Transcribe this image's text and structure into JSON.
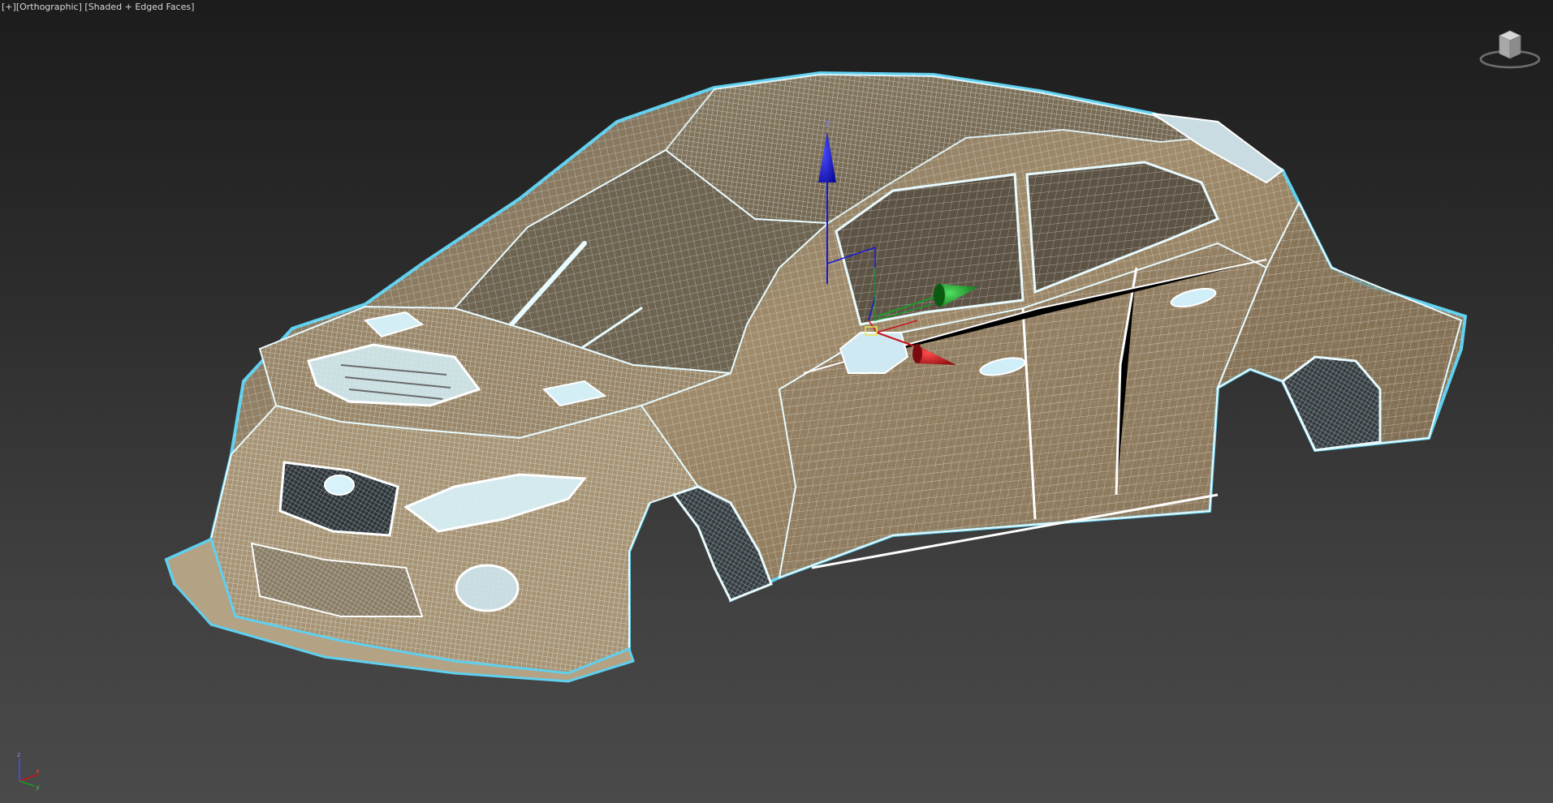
{
  "viewport": {
    "label_plus": "[+]",
    "label_view": "[Orthographic]",
    "label_shading": "[Shaded + Edged Faces]"
  },
  "gizmo": {
    "axis_z": "Z",
    "axis_x": "X",
    "axis_y": "Y"
  },
  "tripod": {
    "z": "z",
    "x": "x",
    "y": "y"
  },
  "colors": {
    "wire": "#e8fbff",
    "outline": "#5fd0ef",
    "body_light": "#9c8a6a",
    "body_dark": "#5c5043",
    "gizmo_x": "#c8141e",
    "gizmo_y": "#1a9a2a",
    "gizmo_z": "#1818d8"
  },
  "icons": {
    "viewcube": "viewcube-icon",
    "tripod": "axis-tripod-icon",
    "gizmo": "move-gizmo-icon"
  }
}
